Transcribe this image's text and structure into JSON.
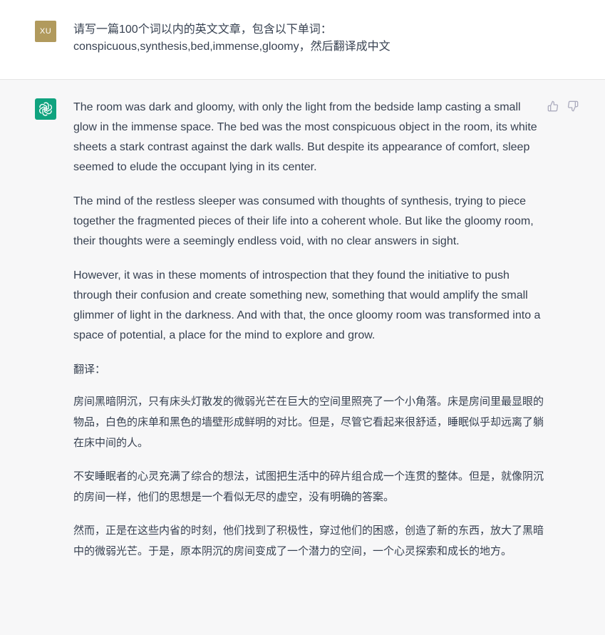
{
  "user": {
    "avatar_initials": "XU",
    "message_line1": "请写一篇100个词以内的英文文章，包含以下单词：",
    "message_line2": "conspicuous,synthesis,bed,immense,gloomy，然后翻译成中文"
  },
  "assistant": {
    "paragraphs": [
      "The room was dark and gloomy, with only the light from the bedside lamp casting a small glow in the immense space. The bed was the most conspicuous object in the room, its white sheets a stark contrast against the dark walls. But despite its appearance of comfort, sleep seemed to elude the occupant lying in its center.",
      "The mind of the restless sleeper was consumed with thoughts of synthesis, trying to piece together the fragmented pieces of their life into a coherent whole. But like the gloomy room, their thoughts were a seemingly endless void, with no clear answers in sight.",
      "However, it was in these moments of introspection that they found the initiative to push through their confusion and create something new, something that would amplify the small glimmer of light in the darkness. And with that, the once gloomy room was transformed into a space of potential, a place for the mind to explore and grow."
    ],
    "translation_label": "翻译：",
    "translation": [
      "房间黑暗阴沉，只有床头灯散发的微弱光芒在巨大的空间里照亮了一个小角落。床是房间里最显眼的物品，白色的床单和黑色的墙壁形成鲜明的对比。但是，尽管它看起来很舒适，睡眠似乎却远离了躺在床中间的人。",
      "不安睡眠者的心灵充满了综合的想法，试图把生活中的碎片组合成一个连贯的整体。但是，就像阴沉的房间一样，他们的思想是一个看似无尽的虚空，没有明确的答案。",
      "然而，正是在这些内省的时刻，他们找到了积极性，穿过他们的困惑，创造了新的东西，放大了黑暗中的微弱光芒。于是，原本阴沉的房间变成了一个潜力的空间，一个心灵探索和成长的地方。"
    ]
  },
  "icons": {
    "thumbs_up": "thumbs-up-icon",
    "thumbs_down": "thumbs-down-icon",
    "assistant_logo": "openai-logo-icon"
  },
  "colors": {
    "user_avatar": "#b19a5d",
    "assistant_avatar": "#10a37f",
    "assistant_bg": "#f7f7f8",
    "text": "#374151"
  }
}
